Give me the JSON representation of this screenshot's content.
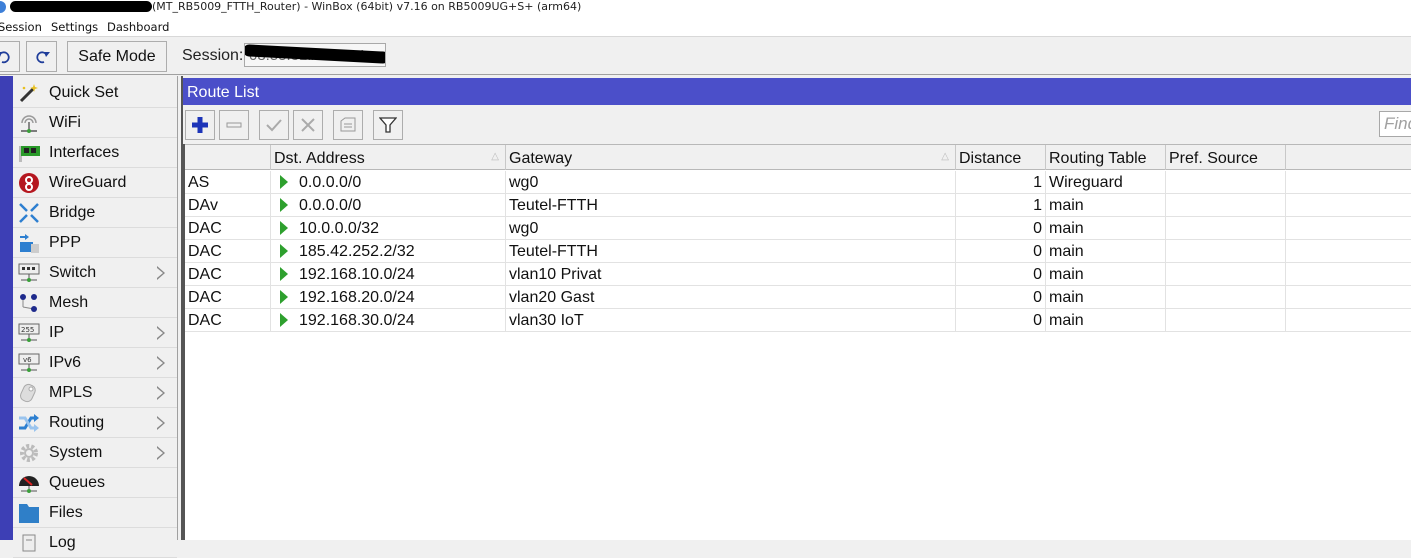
{
  "window": {
    "title": "(MT_RB5009_FTTH_Router) - WinBox (64bit) v7.16 on RB5009UG+S+ (arm64)",
    "title_prefix_redacted": true
  },
  "menubar": {
    "items": [
      "Session",
      "Settings",
      "Dashboard"
    ]
  },
  "toolbar": {
    "undo_icon": "undo-icon",
    "redo_icon": "redo-icon",
    "safe_mode_label": "Safe Mode",
    "session_label": "Session:",
    "session_value": "08:55:31:A2:0A:4",
    "session_value_redacted": true
  },
  "sidebar": {
    "items": [
      {
        "label": "Quick Set",
        "icon": "magic-wand-icon",
        "submenu": false
      },
      {
        "label": "WiFi",
        "icon": "wifi-antenna-icon",
        "submenu": false
      },
      {
        "label": "Interfaces",
        "icon": "network-card-icon",
        "submenu": false
      },
      {
        "label": "WireGuard",
        "icon": "wireguard-icon",
        "submenu": false
      },
      {
        "label": "Bridge",
        "icon": "bridge-arrows-icon",
        "submenu": false
      },
      {
        "label": "PPP",
        "icon": "ppp-icon",
        "submenu": false
      },
      {
        "label": "Switch",
        "icon": "switch-icon",
        "submenu": true
      },
      {
        "label": "Mesh",
        "icon": "mesh-icon",
        "submenu": false
      },
      {
        "label": "IP",
        "icon": "ip-icon",
        "submenu": true
      },
      {
        "label": "IPv6",
        "icon": "ipv6-icon",
        "submenu": true
      },
      {
        "label": "MPLS",
        "icon": "mpls-icon",
        "submenu": true
      },
      {
        "label": "Routing",
        "icon": "routing-icon",
        "submenu": true
      },
      {
        "label": "System",
        "icon": "gear-icon",
        "submenu": true
      },
      {
        "label": "Queues",
        "icon": "gauge-icon",
        "submenu": false
      },
      {
        "label": "Files",
        "icon": "folder-icon",
        "submenu": false
      },
      {
        "label": "Log",
        "icon": "log-icon",
        "submenu": false
      }
    ]
  },
  "route_list": {
    "title": "Route List",
    "toolbar": [
      "add-icon",
      "remove-icon",
      "enable-icon",
      "disable-icon",
      "comment-icon",
      "filter-icon"
    ],
    "find_placeholder": "Find",
    "columns": [
      "",
      "Dst. Address",
      "Gateway",
      "Distance",
      "Routing Table",
      "Pref. Source",
      ""
    ],
    "sorted_column": "Dst. Address",
    "rows": [
      {
        "flags": "AS",
        "dst": "0.0.0.0/0",
        "gateway": "wg0",
        "distance": "1",
        "table": "Wireguard",
        "pref_source": ""
      },
      {
        "flags": "DAv",
        "dst": "0.0.0.0/0",
        "gateway": "Teutel-FTTH",
        "distance": "1",
        "table": "main",
        "pref_source": ""
      },
      {
        "flags": "DAC",
        "dst": "10.0.0.0/32",
        "gateway": "wg0",
        "distance": "0",
        "table": "main",
        "pref_source": ""
      },
      {
        "flags": "DAC",
        "dst": "185.42.252.2/32",
        "gateway": "Teutel-FTTH",
        "distance": "0",
        "table": "main",
        "pref_source": ""
      },
      {
        "flags": "DAC",
        "dst": "192.168.10.0/24",
        "gateway": "vlan10 Privat",
        "distance": "0",
        "table": "main",
        "pref_source": ""
      },
      {
        "flags": "DAC",
        "dst": "192.168.20.0/24",
        "gateway": "vlan20 Gast",
        "distance": "0",
        "table": "main",
        "pref_source": ""
      },
      {
        "flags": "DAC",
        "dst": "192.168.30.0/24",
        "gateway": "vlan30 IoT",
        "distance": "0",
        "table": "main",
        "pref_source": ""
      }
    ]
  },
  "colors": {
    "title_bar": "#4b4fc9",
    "sidebar_strip": "#3d3fb5",
    "active_route_arrow": "#2ea02e"
  }
}
